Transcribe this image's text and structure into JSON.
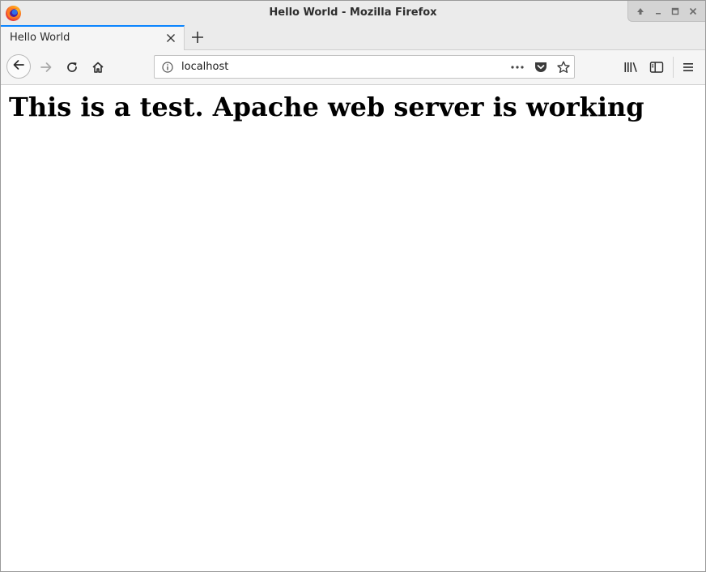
{
  "window": {
    "title": "Hello World - Mozilla Firefox"
  },
  "tab": {
    "label": "Hello World"
  },
  "urlbar": {
    "url": "localhost"
  },
  "page": {
    "heading": "This is a test. Apache web server is working"
  },
  "colors": {
    "tab_accent": "#0a84ff",
    "chrome_bg": "#ebebeb",
    "toolbar_bg": "#f5f5f5"
  },
  "icons": {
    "logo": "firefox-logo-icon",
    "back": "arrow-left-icon",
    "forward": "arrow-right-icon",
    "reload": "reload-icon",
    "home": "home-icon",
    "info": "info-icon",
    "more": "ellipsis-icon",
    "pocket": "pocket-icon",
    "bookmark": "star-icon",
    "library": "library-icon",
    "sidebar": "sidebar-icon",
    "menu": "hamburger-menu-icon"
  }
}
